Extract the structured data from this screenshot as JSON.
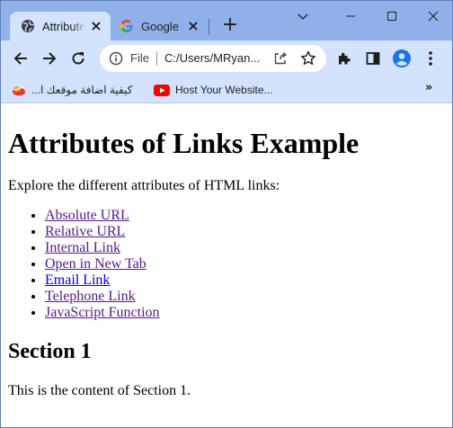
{
  "browser": {
    "tabs": [
      {
        "title": "Attributes of Links Example",
        "icon": "globe-icon",
        "active": true
      },
      {
        "title": "Google",
        "icon": "google-icon",
        "active": false
      }
    ],
    "omnibox": {
      "scheme_label": "File",
      "url": "C:/Users/MRyan..."
    },
    "bookmarks": [
      {
        "label": "كيفية اضافة موقعك ا...",
        "icon": "bookmark-favicon-icon"
      },
      {
        "label": "Host Your Website...",
        "icon": "youtube-icon"
      }
    ],
    "bookmarks_more": "»"
  },
  "page": {
    "heading": "Attributes of Links Example",
    "intro": "Explore the different attributes of HTML links:",
    "links": [
      {
        "label": "Absolute URL",
        "state": "visited"
      },
      {
        "label": "Relative URL",
        "state": "visited"
      },
      {
        "label": "Internal Link",
        "state": "visited"
      },
      {
        "label": "Open in New Tab",
        "state": "visited"
      },
      {
        "label": "Email Link",
        "state": "unvisited"
      },
      {
        "label": "Telephone Link",
        "state": "visited"
      },
      {
        "label": "JavaScript Function",
        "state": "visited"
      }
    ],
    "section_heading": "Section 1",
    "section_text": "This is the content of Section 1."
  },
  "colors": {
    "titlebar": "#8fb0e8",
    "toolbar": "#d3e3fd",
    "visited_link": "#551a8b",
    "unvisited_link": "#0000ee"
  }
}
